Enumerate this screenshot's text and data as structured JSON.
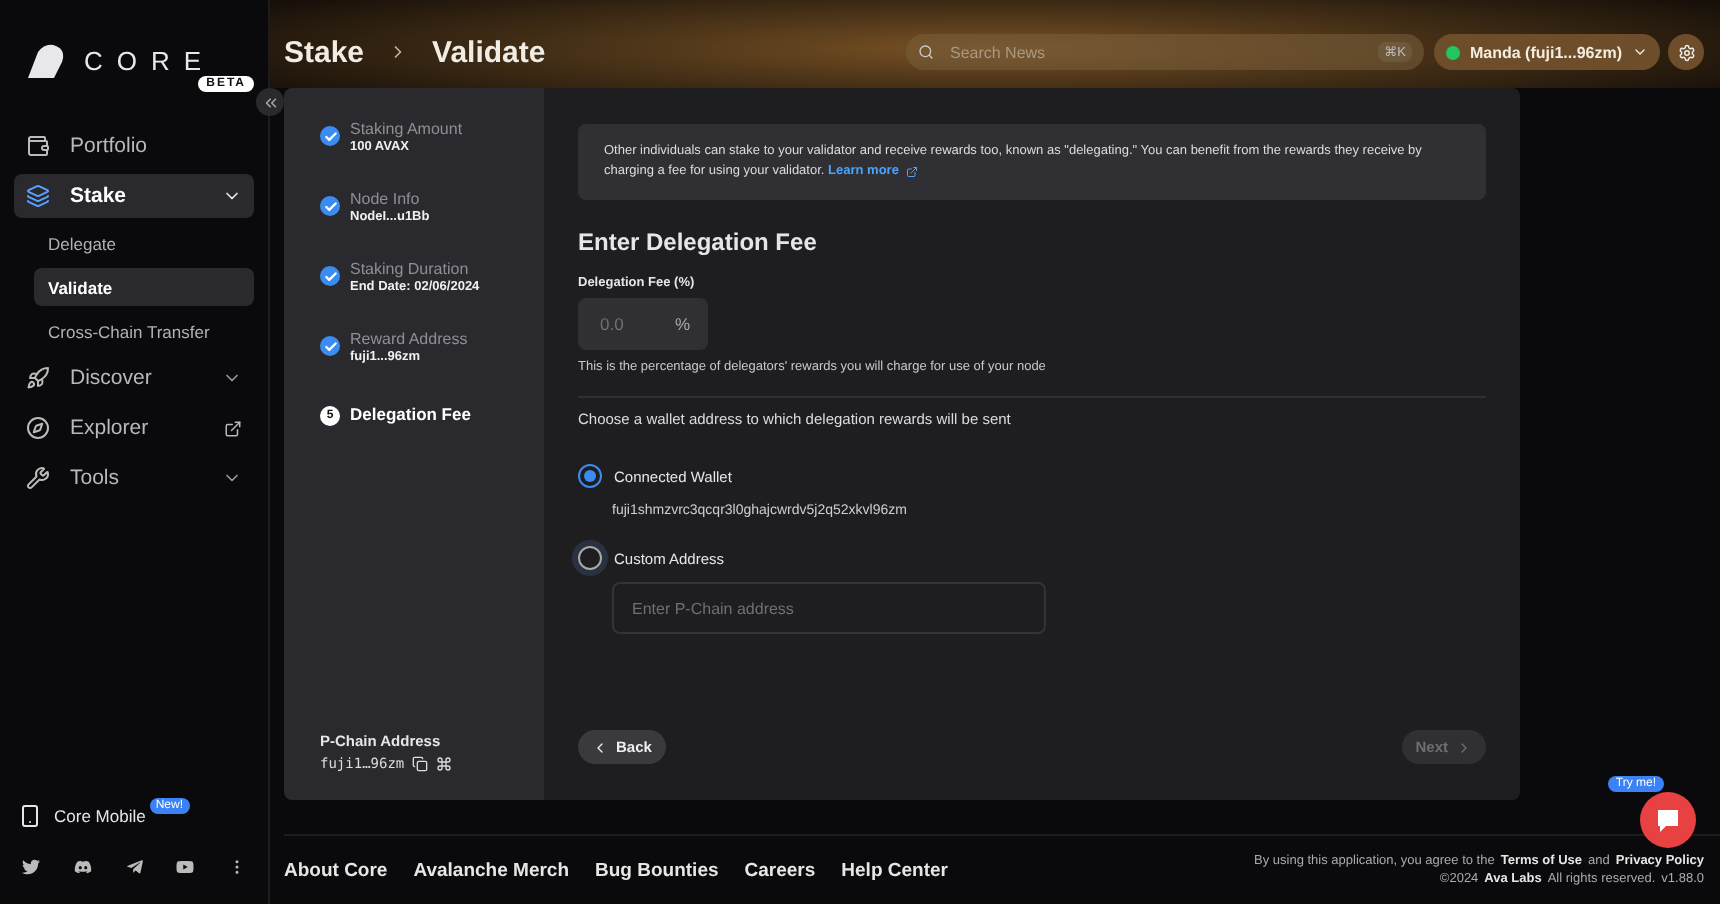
{
  "logo": {
    "wordmark": "CORE",
    "badge": "BETA"
  },
  "sidebar": {
    "items": [
      {
        "label": "Portfolio",
        "selected": false
      },
      {
        "label": "Stake",
        "selected": true,
        "expanded": true,
        "children": [
          {
            "label": "Delegate",
            "selected": false
          },
          {
            "label": "Validate",
            "selected": true
          },
          {
            "label": "Cross-Chain Transfer",
            "selected": false
          }
        ]
      },
      {
        "label": "Discover",
        "selected": false,
        "expanded": false
      },
      {
        "label": "Explorer",
        "selected": false,
        "external": true
      },
      {
        "label": "Tools",
        "selected": false,
        "expanded": false
      }
    ],
    "mobile": {
      "label": "Core Mobile",
      "badge": "New!"
    }
  },
  "header": {
    "breadcrumb": [
      "Stake",
      "Validate"
    ],
    "search": {
      "placeholder": "Search News",
      "shortcut": "⌘K"
    },
    "account": "Manda (fuji1...96zm)"
  },
  "steps": [
    {
      "title": "Staking Amount",
      "value": "100 AVAX",
      "kind": "done"
    },
    {
      "title": "Node Info",
      "value": "NodeI...u1Bb",
      "kind": "done"
    },
    {
      "title": "Staking Duration",
      "value": "End Date: 02/06/2024",
      "kind": "done"
    },
    {
      "title": "Reward Address",
      "value": "fuji1...96zm",
      "kind": "done"
    },
    {
      "title": "Delegation Fee",
      "number": "5",
      "kind": "current"
    }
  ],
  "p_chain": {
    "label": "P-Chain Address",
    "value": "fuji1…96zm"
  },
  "info": {
    "text": "Other individuals can stake to your validator and receive rewards too, known as \"delegating.\" You can benefit from the rewards they receive by charging a fee for using your validator.",
    "link": "Learn more"
  },
  "form": {
    "title": "Enter Delegation Fee",
    "fee_label": "Delegation Fee (%)",
    "fee_placeholder": "0.0",
    "fee_suffix": "%",
    "fee_help": "This is the percentage of delegators' rewards you will charge for use of your node",
    "question": "Choose a wallet address to which delegation rewards will be sent",
    "options": [
      {
        "label": "Connected Wallet",
        "selected": true,
        "address": "fuji1shmzvrc3qcqr3l0ghajcwrdv5j2q52xkvl96zm"
      },
      {
        "label": "Custom Address",
        "selected": false,
        "placeholder": "Enter P-Chain address"
      }
    ]
  },
  "buttons": {
    "back": "Back",
    "next": {
      "label": "Next",
      "disabled": true
    }
  },
  "footer": {
    "links": [
      "About Core",
      "Avalanche Merch",
      "Bug Bounties",
      "Careers",
      "Help Center"
    ],
    "legal_prefix": "By using this application, you agree to the",
    "terms": "Terms of Use",
    "and": "and",
    "privacy": "Privacy Policy",
    "copyright": "©2024",
    "company": "Ava Labs",
    "rights": "All rights reserved.",
    "version": "v1.88.0"
  },
  "chat": {
    "badge": "Try me!"
  }
}
